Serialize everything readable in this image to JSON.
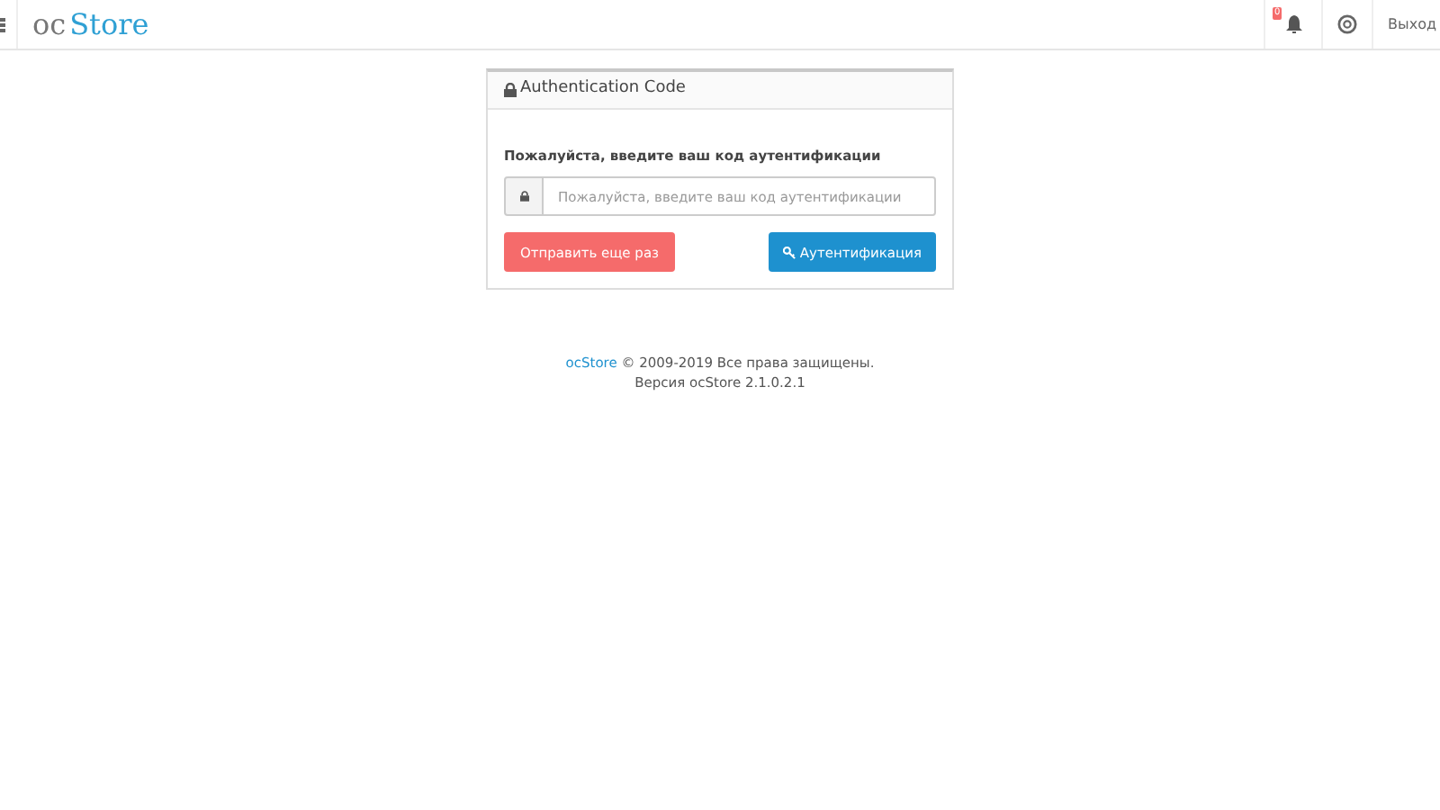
{
  "header": {
    "logo": {
      "prefix": "oc",
      "name": "Store"
    },
    "notification_badge": "0",
    "logout": "Выход"
  },
  "panel": {
    "title": "Authentication Code",
    "label": "Пожалуйста, введите ваш код аутентификации",
    "placeholder": "Пожалуйста, введите ваш код аутентификации",
    "resend_button": "Отправить еще раз",
    "auth_button": "Аутентификация"
  },
  "footer": {
    "link": "ocStore",
    "copyright": "© 2009-2019 Все права защищены.",
    "version": "Версия ocStore 2.1.0.2.1"
  }
}
